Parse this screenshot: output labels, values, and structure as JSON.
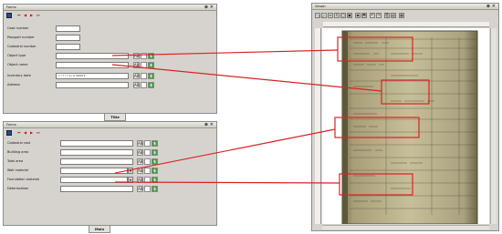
{
  "form_top": {
    "title": "Forms",
    "controls": "⊗ ✕",
    "toolbar": {
      "save_icon": "save-icon",
      "nav": [
        "⏮",
        "◀",
        "▶",
        "⏭"
      ]
    },
    "fields": [
      {
        "label": "Case number"
      },
      {
        "label": "Passport number"
      },
      {
        "label": "Cadastral number"
      },
      {
        "label": "Object type"
      },
      {
        "label": "Object name"
      },
      {
        "label": "Inventory date",
        "value": "? / ? / ?   0 / 0   2000 ▾"
      },
      {
        "label": "Address"
      }
    ],
    "tab_label": "Title"
  },
  "form_bottom": {
    "title": "Forms",
    "controls": "⊗ ✕",
    "toolbar": {
      "save_icon": "save-icon",
      "nav": [
        "⏮",
        "◀",
        "▶",
        "⏭"
      ]
    },
    "fields": [
      {
        "label": "Cadastral cost"
      },
      {
        "label": "Building area"
      },
      {
        "label": "Total area"
      },
      {
        "label": "Wall material"
      },
      {
        "label": "Foundation material"
      },
      {
        "label": "Deterioration"
      }
    ],
    "tab_label": "Main"
  },
  "field_buttons": [
    "AB",
    "",
    "$"
  ],
  "viewer": {
    "title": "Viewer",
    "controls": "⊗ ✕",
    "tools": [
      "🔍",
      "🔎",
      "⇔",
      "⇕",
      "▢",
      "▣",
      "◉",
      "⬒",
      "↶",
      "↷",
      "⎘",
      "▤",
      "▦"
    ]
  },
  "colors": {
    "link_line": "#d92323",
    "form_bg": "#d6d3ce"
  }
}
